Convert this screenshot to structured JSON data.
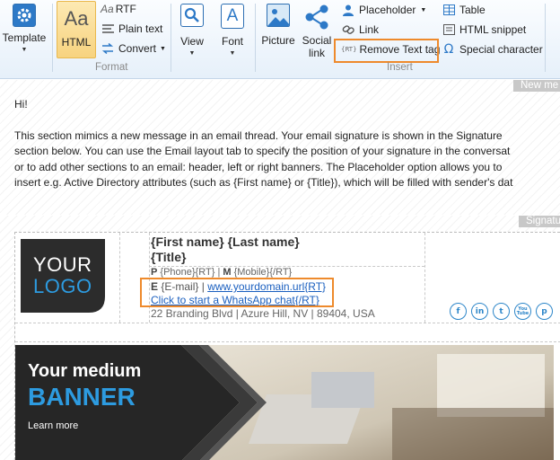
{
  "ribbon": {
    "template": {
      "label": "Template"
    },
    "html": {
      "label": "HTML",
      "glyph": "Aa"
    },
    "rtf": {
      "label": "RTF",
      "glyph": "Aa"
    },
    "plain_text": {
      "label": "Plain text"
    },
    "convert": {
      "label": "Convert"
    },
    "format_group": "Format",
    "view": {
      "label": "View"
    },
    "font": {
      "label": "Font",
      "glyph": "A"
    },
    "picture": {
      "label": "Picture"
    },
    "social_link": {
      "label_line1": "Social",
      "label_line2": "link"
    },
    "placeholder": {
      "label": "Placeholder"
    },
    "link": {
      "label": "Link"
    },
    "remove_text_tag": {
      "label": "Remove Text tag",
      "glyph": "{RT}"
    },
    "table": {
      "label": "Table"
    },
    "html_snippet": {
      "label": "HTML snippet"
    },
    "special_character": {
      "label": "Special character"
    },
    "insert_group": "Insert"
  },
  "new_message_tag": "New me",
  "signature_tag": "Signatu",
  "message_body": {
    "greeting": "Hi!",
    "lines": [
      "This section mimics a new message in an email thread. Your email signature is shown in the Signature",
      "section below. You can use the Email layout tab to specify the position of your signature in the conversat",
      "or to add other sections to an email: header, left or right banners. The Placeholder option allows you to",
      "insert e.g. Active Directory attributes (such as {First name} or {Title}), which will be filled with sender's dat"
    ]
  },
  "signature": {
    "logo": {
      "line1": "YOUR",
      "line2": "LOGO"
    },
    "name": "{First name} {Last name}",
    "title": "{Title}",
    "phone_label": "P",
    "phone_value": "{Phone}{RT}",
    "sep": "|",
    "mobile_label": "M",
    "mobile_value": "{Mobile}{/RT}",
    "email_label": "E",
    "email_value": "{E-mail}",
    "website": "www.yourdomain.url{RT}",
    "whatsapp_link": "Click to start a WhatsApp chat",
    "whatsapp_tag": "{/RT}",
    "address": "22 Branding Blvd | Azure Hill, NV | 89404, USA",
    "social_icons": [
      "f",
      "in",
      "t",
      "You Tube",
      "p"
    ],
    "banner": {
      "line1": "Your medium",
      "line2": "BANNER",
      "cta": "Learn more"
    }
  },
  "colors": {
    "accent": "#2d86c9",
    "highlight": "#ee8a2c",
    "logo_bg": "#2c2c2c",
    "banner_blue": "#2d9be0"
  }
}
